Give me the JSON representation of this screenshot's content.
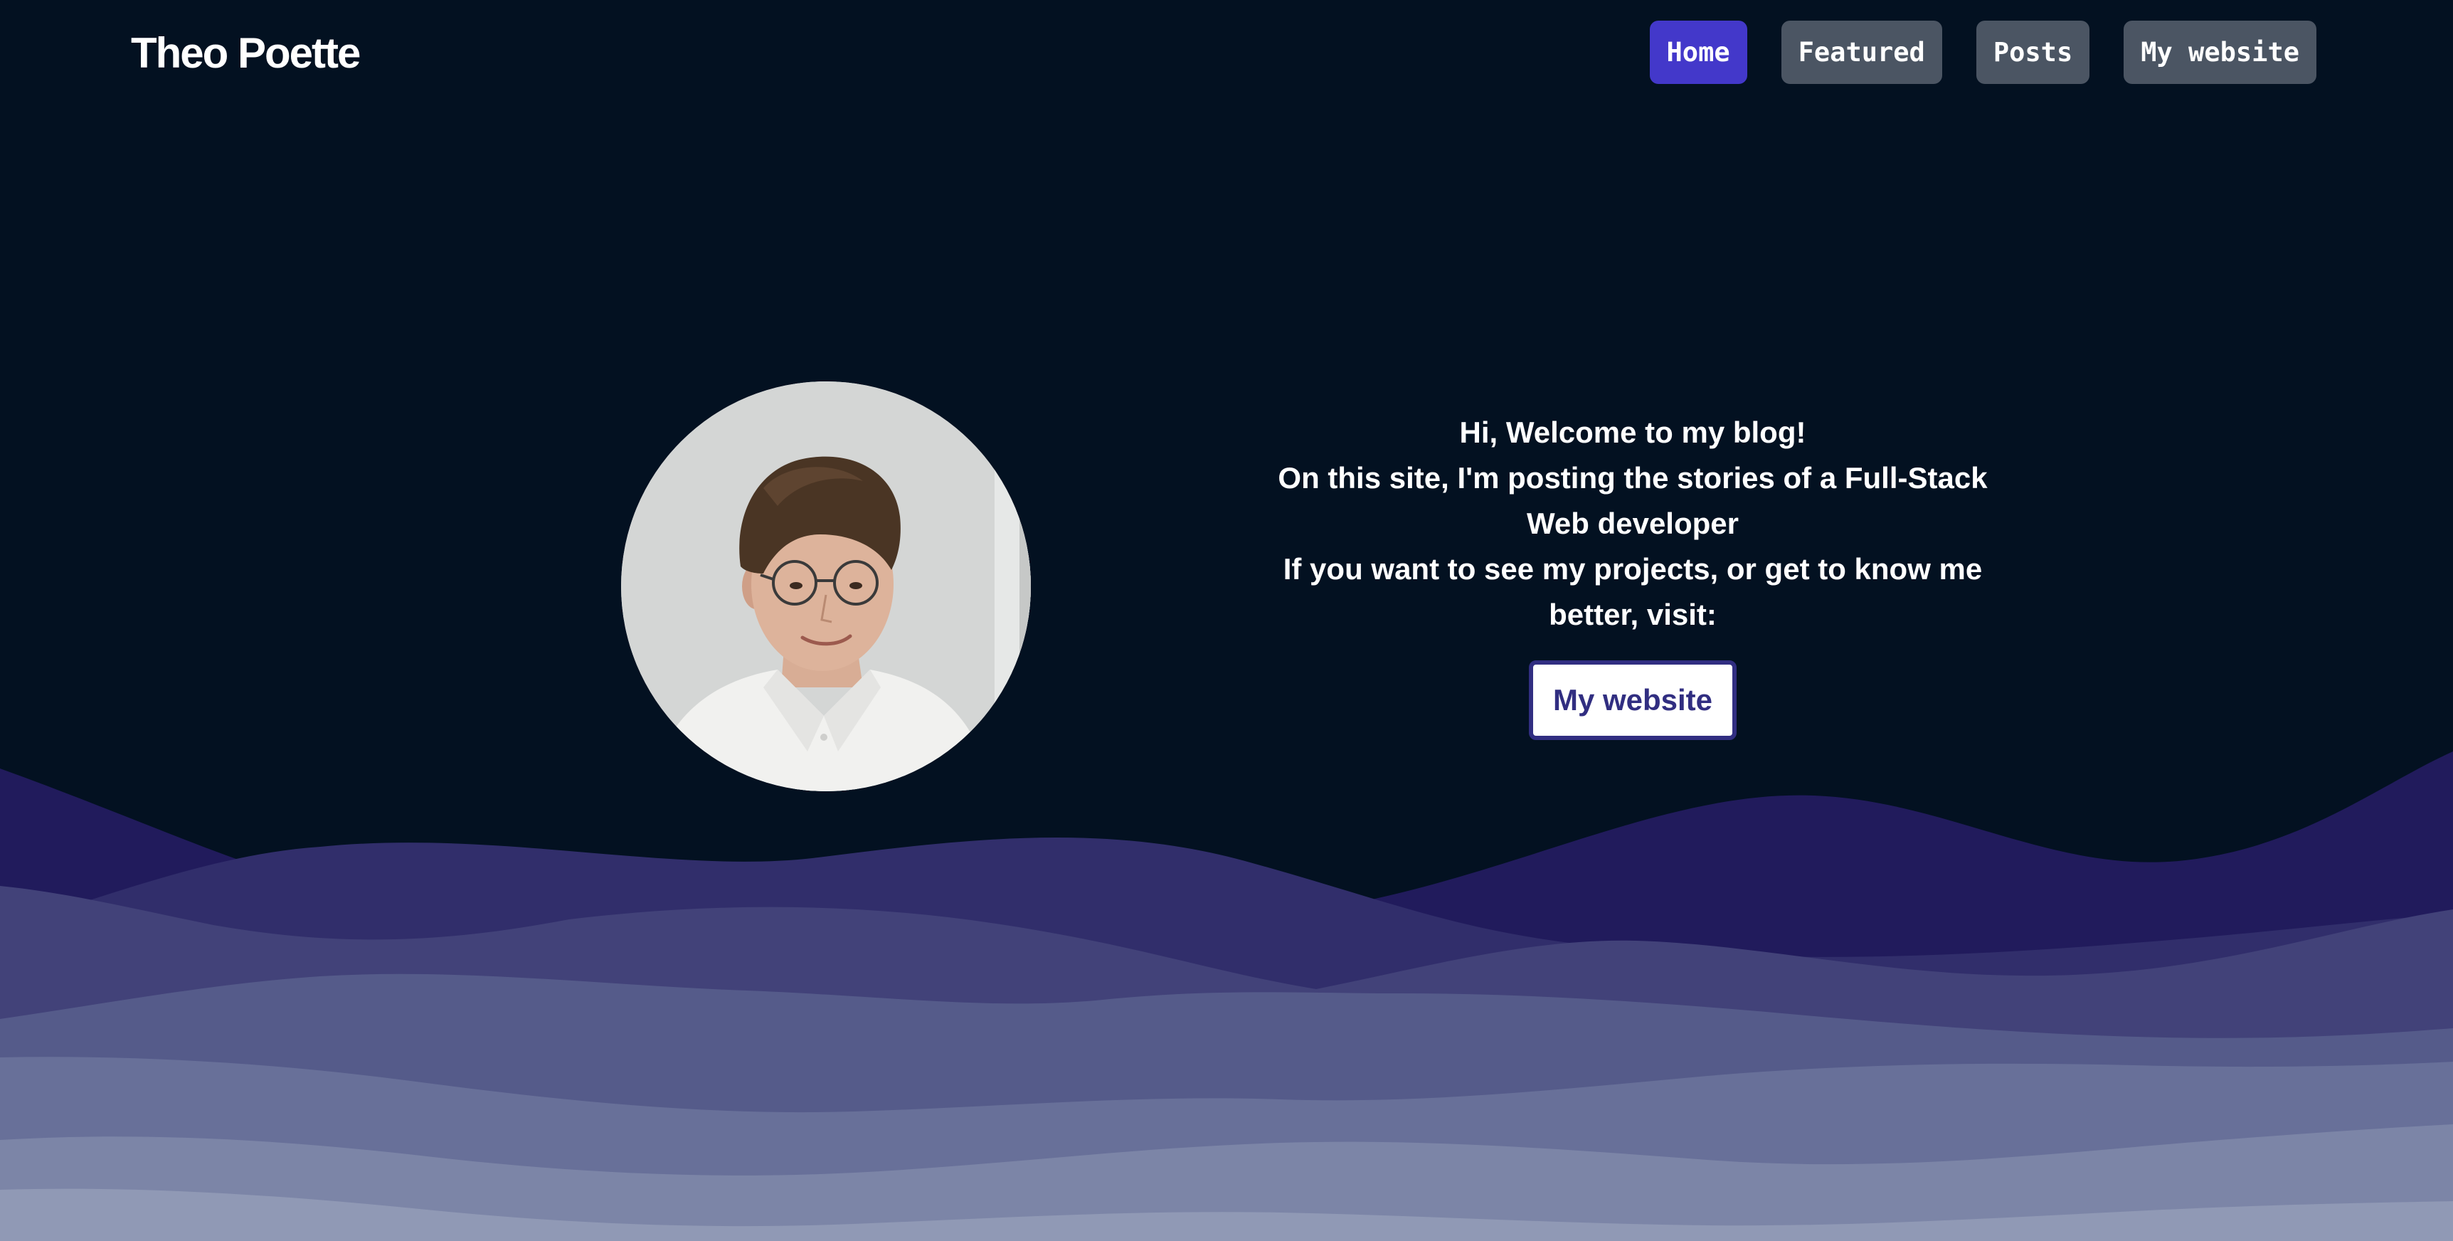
{
  "header": {
    "site_title": "Theo Poette",
    "nav": [
      {
        "label": "Home",
        "active": true
      },
      {
        "label": "Featured",
        "active": false
      },
      {
        "label": "Posts",
        "active": false
      },
      {
        "label": "My website",
        "active": false
      }
    ]
  },
  "hero": {
    "greeting": "Hi, Welcome to my blog!",
    "intro_line": "On this site, I'm posting the stories of a Full-Stack Web developer",
    "visit_line": "If you want to see my projects, or get to know me better, visit:",
    "cta_label": "My website"
  },
  "colors": {
    "background": "#031121",
    "nav_active": "#4338ca",
    "nav_default": "#4b5563",
    "cta_border": "#312e81",
    "wave_1": "#211b5c",
    "wave_2": "#312e6b",
    "wave_3": "#424279",
    "wave_4": "#555b8a",
    "wave_5": "#687099",
    "wave_6": "#7c85a7",
    "wave_7": "#9099b5"
  }
}
